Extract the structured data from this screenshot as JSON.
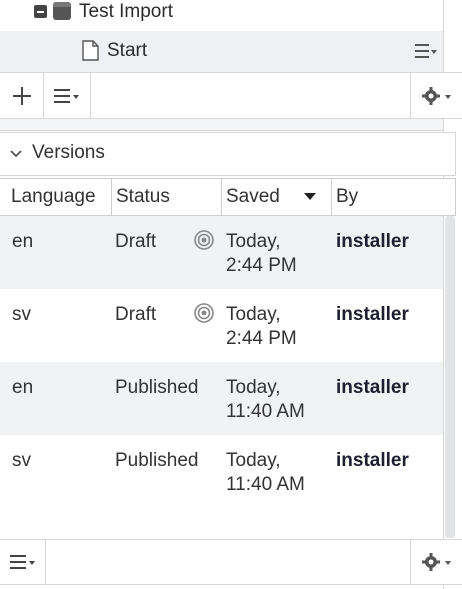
{
  "tree": {
    "parent_label": "Test Import",
    "child_label": "Start"
  },
  "versions": {
    "title": "Versions"
  },
  "grid": {
    "columns": [
      "Language",
      "Status",
      "Saved",
      "By"
    ],
    "sorted_column": "Saved",
    "rows": [
      {
        "language": "en",
        "status": "Draft",
        "saved_line1": "Today,",
        "saved_line2": "2:44 PM",
        "by": "installer",
        "draft_marker": true,
        "highlighted": true
      },
      {
        "language": "sv",
        "status": "Draft",
        "saved_line1": "Today,",
        "saved_line2": "2:44 PM",
        "by": "installer",
        "draft_marker": true,
        "highlighted": false
      },
      {
        "language": "en",
        "status": "Published",
        "saved_line1": "Today,",
        "saved_line2": "11:40 AM",
        "by": "installer",
        "draft_marker": false,
        "highlighted": true
      },
      {
        "language": "sv",
        "status": "Published",
        "saved_line1": "Today,",
        "saved_line2": "11:40 AM",
        "by": "installer",
        "draft_marker": false,
        "highlighted": false
      }
    ]
  },
  "icons": {
    "expand_toggle": "minus-square-icon",
    "database": "database-icon",
    "page": "page-icon",
    "row_menu": "list-menu-icon",
    "add": "plus-icon",
    "list": "list-menu-icon",
    "settings": "gear-icon",
    "collapse": "chevron-down-icon",
    "sort": "sort-desc-icon",
    "draft": "target-icon"
  },
  "colors": {
    "row_highlight": "#f1f2f4",
    "tree_selected": "#eef0f3",
    "border": "#d6d6d6",
    "text": "#333333"
  }
}
